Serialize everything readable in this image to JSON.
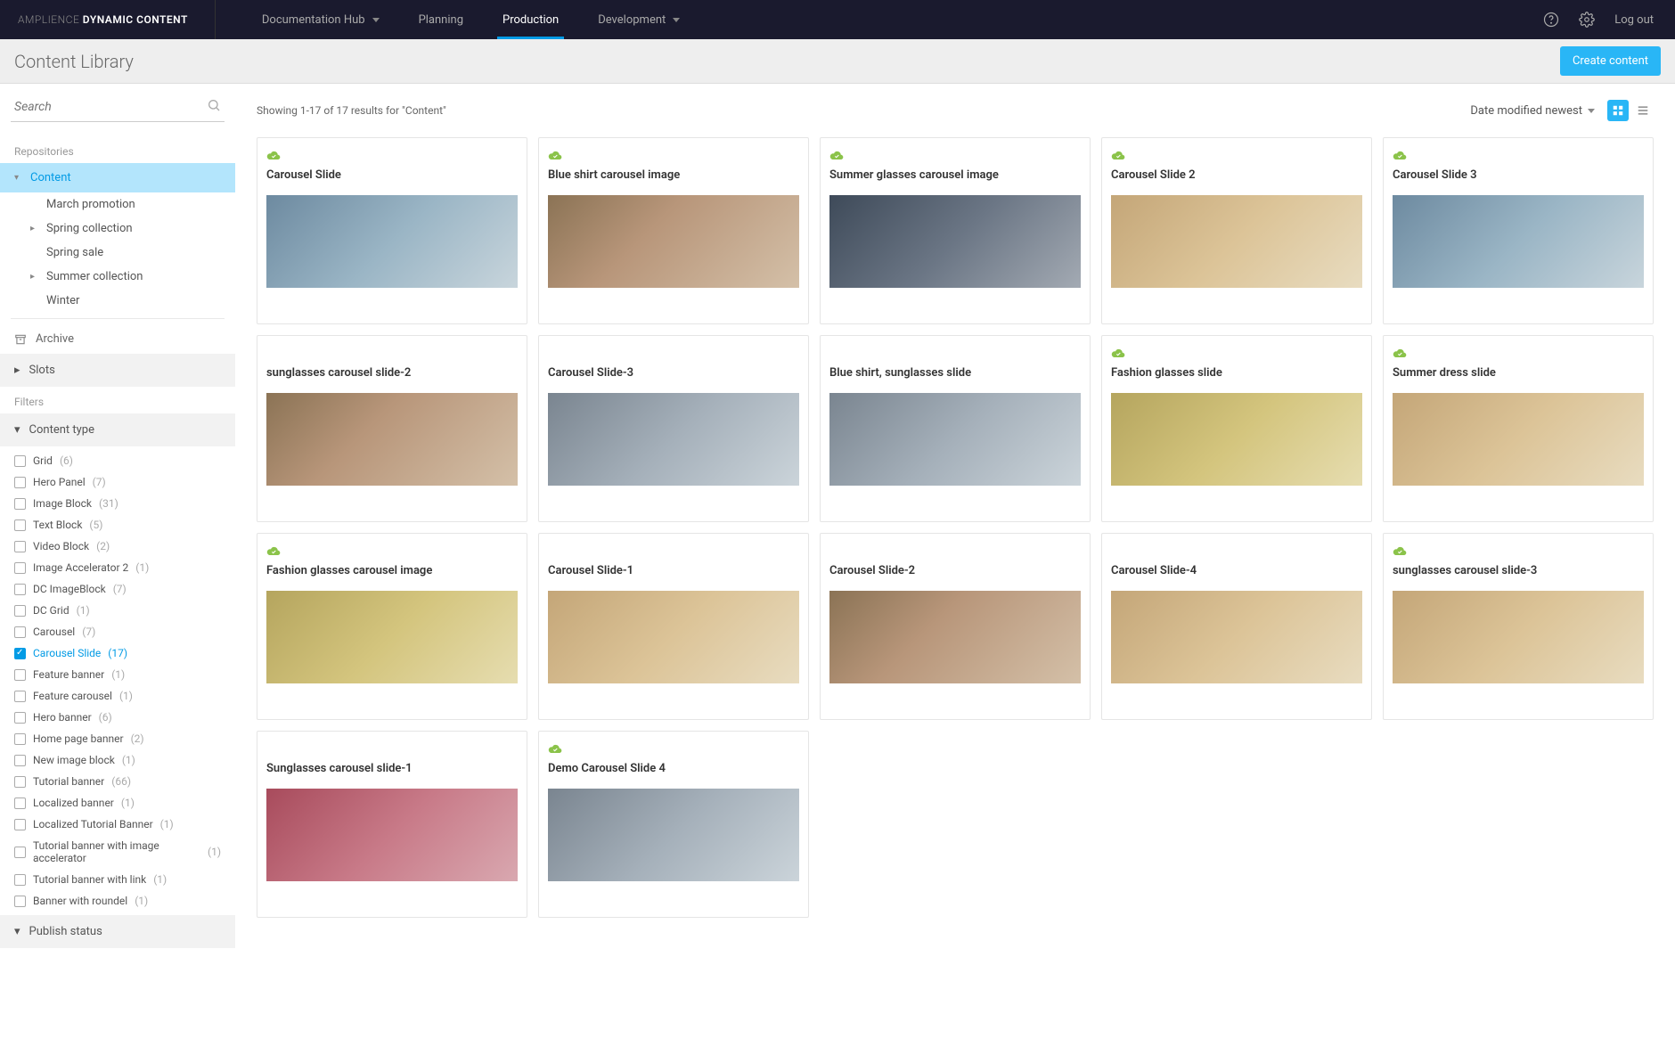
{
  "brand": {
    "light": "AMPLIENCE",
    "bold": "DYNAMIC CONTENT"
  },
  "nav": {
    "items": [
      {
        "label": "Documentation Hub",
        "dropdown": true,
        "active": false
      },
      {
        "label": "Planning",
        "dropdown": false,
        "active": false
      },
      {
        "label": "Production",
        "dropdown": false,
        "active": true
      },
      {
        "label": "Development",
        "dropdown": true,
        "active": false
      }
    ],
    "logout": "Log out"
  },
  "page": {
    "title": "Content Library",
    "create_button": "Create content"
  },
  "search": {
    "placeholder": "Search"
  },
  "sidebar": {
    "repositories_label": "Repositories",
    "content_label": "Content",
    "content_children": [
      {
        "label": "March promotion",
        "expandable": false
      },
      {
        "label": "Spring collection",
        "expandable": true
      },
      {
        "label": "Spring sale",
        "expandable": false
      },
      {
        "label": "Summer collection",
        "expandable": true
      },
      {
        "label": "Winter",
        "expandable": false
      }
    ],
    "archive_label": "Archive",
    "slots_label": "Slots",
    "filters_label": "Filters",
    "content_type_label": "Content type",
    "content_types": [
      {
        "label": "Grid",
        "count": "(6)",
        "checked": false
      },
      {
        "label": "Hero Panel",
        "count": "(7)",
        "checked": false
      },
      {
        "label": "Image Block",
        "count": "(31)",
        "checked": false
      },
      {
        "label": "Text Block",
        "count": "(5)",
        "checked": false
      },
      {
        "label": "Video Block",
        "count": "(2)",
        "checked": false
      },
      {
        "label": "Image Accelerator 2",
        "count": "(1)",
        "checked": false
      },
      {
        "label": "DC ImageBlock",
        "count": "(7)",
        "checked": false
      },
      {
        "label": "DC Grid",
        "count": "(1)",
        "checked": false
      },
      {
        "label": "Carousel",
        "count": "(7)",
        "checked": false
      },
      {
        "label": "Carousel Slide",
        "count": "(17)",
        "checked": true
      },
      {
        "label": "Feature banner",
        "count": "(1)",
        "checked": false
      },
      {
        "label": "Feature carousel",
        "count": "(1)",
        "checked": false
      },
      {
        "label": "Hero banner",
        "count": "(6)",
        "checked": false
      },
      {
        "label": "Home page banner",
        "count": "(2)",
        "checked": false
      },
      {
        "label": "New image block",
        "count": "(1)",
        "checked": false
      },
      {
        "label": "Tutorial banner",
        "count": "(66)",
        "checked": false
      },
      {
        "label": "Localized banner",
        "count": "(1)",
        "checked": false
      },
      {
        "label": "Localized Tutorial Banner",
        "count": "(1)",
        "checked": false
      },
      {
        "label": "Tutorial banner with image accelerator",
        "count": "(1)",
        "checked": false
      },
      {
        "label": "Tutorial banner with link",
        "count": "(1)",
        "checked": false
      },
      {
        "label": "Banner with roundel",
        "count": "(1)",
        "checked": false
      }
    ],
    "publish_status_label": "Publish status"
  },
  "main": {
    "results_text": "Showing 1-17 of 17 results for \"Content\"",
    "sort_label": "Date modified newest",
    "cards": [
      {
        "title": "Carousel Slide",
        "published": true,
        "thumb": "a"
      },
      {
        "title": "Blue shirt carousel image",
        "published": true,
        "thumb": "b"
      },
      {
        "title": "Summer glasses carousel image",
        "published": true,
        "thumb": "c"
      },
      {
        "title": "Carousel Slide 2",
        "published": true,
        "thumb": "d"
      },
      {
        "title": "Carousel Slide 3",
        "published": true,
        "thumb": "a"
      },
      {
        "title": "sunglasses carousel slide-2",
        "published": false,
        "thumb": "b"
      },
      {
        "title": "Carousel Slide-3",
        "published": false,
        "thumb": "g"
      },
      {
        "title": "Blue shirt, sunglasses slide",
        "published": false,
        "thumb": "g"
      },
      {
        "title": "Fashion glasses slide",
        "published": true,
        "thumb": "f"
      },
      {
        "title": "Summer dress slide",
        "published": true,
        "thumb": "d"
      },
      {
        "title": "Fashion glasses carousel image",
        "published": true,
        "thumb": "f"
      },
      {
        "title": "Carousel Slide-1",
        "published": false,
        "thumb": "d"
      },
      {
        "title": "Carousel Slide-2",
        "published": false,
        "thumb": "b"
      },
      {
        "title": "Carousel Slide-4",
        "published": false,
        "thumb": "d"
      },
      {
        "title": "sunglasses carousel slide-3",
        "published": true,
        "thumb": "d"
      },
      {
        "title": "Sunglasses carousel slide-1",
        "published": false,
        "thumb": "e"
      },
      {
        "title": "Demo Carousel Slide 4",
        "published": true,
        "thumb": "g"
      }
    ]
  }
}
